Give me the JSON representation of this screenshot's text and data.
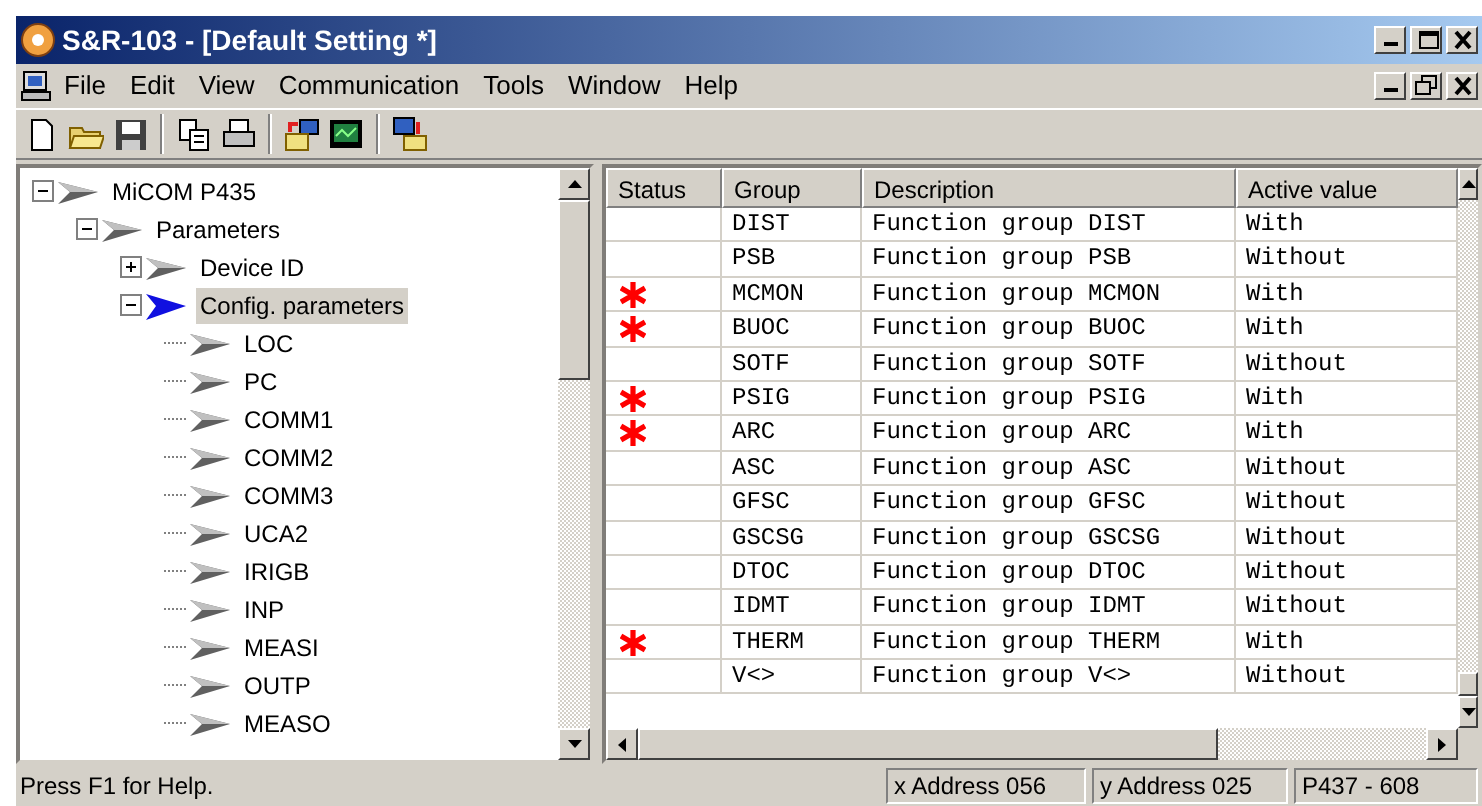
{
  "window": {
    "title": "S&R-103 - [Default Setting *]"
  },
  "menu": [
    "File",
    "Edit",
    "View",
    "Communication",
    "Tools",
    "Window",
    "Help"
  ],
  "tree": [
    {
      "label": "MiCOM P435",
      "expanded": true,
      "selected": false,
      "children": [
        {
          "label": "Parameters",
          "expanded": true,
          "selected": false,
          "children": [
            {
              "label": "Device ID",
              "expanded": false,
              "selected": false
            },
            {
              "label": "Config. parameters",
              "expanded": true,
              "selected": true,
              "children": [
                {
                  "label": "LOC",
                  "selected": false
                },
                {
                  "label": "PC",
                  "selected": false
                },
                {
                  "label": "COMM1",
                  "selected": false
                },
                {
                  "label": "COMM2",
                  "selected": false
                },
                {
                  "label": "COMM3",
                  "selected": false
                },
                {
                  "label": "UCA2",
                  "selected": false
                },
                {
                  "label": "IRIGB",
                  "selected": false
                },
                {
                  "label": "INP",
                  "selected": false
                },
                {
                  "label": "MEASI",
                  "selected": false
                },
                {
                  "label": "OUTP",
                  "selected": false
                },
                {
                  "label": "MEASO",
                  "selected": false
                }
              ]
            }
          ]
        }
      ]
    }
  ],
  "table": {
    "columns": [
      "Status",
      "Group",
      "Description",
      "Active value"
    ],
    "rows": [
      {
        "changed": false,
        "group": "DIST",
        "description": "Function group DIST",
        "value": "With"
      },
      {
        "changed": false,
        "group": "PSB",
        "description": "Function group PSB",
        "value": "Without"
      },
      {
        "changed": true,
        "group": "MCMON",
        "description": "Function group MCMON",
        "value": "With"
      },
      {
        "changed": true,
        "group": "BUOC",
        "description": "Function group BUOC",
        "value": "With"
      },
      {
        "changed": false,
        "group": "SOTF",
        "description": "Function group SOTF",
        "value": "Without"
      },
      {
        "changed": true,
        "group": "PSIG",
        "description": "Function group PSIG",
        "value": "With"
      },
      {
        "changed": true,
        "group": "ARC",
        "description": "Function group ARC",
        "value": "With"
      },
      {
        "changed": false,
        "group": "ASC",
        "description": "Function group ASC",
        "value": "Without"
      },
      {
        "changed": false,
        "group": "GFSC",
        "description": "Function group GFSC",
        "value": "Without"
      },
      {
        "changed": false,
        "group": "GSCSG",
        "description": "Function group GSCSG",
        "value": "Without"
      },
      {
        "changed": false,
        "group": "DTOC",
        "description": "Function group DTOC",
        "value": "Without"
      },
      {
        "changed": false,
        "group": "IDMT",
        "description": "Function group IDMT",
        "value": "Without"
      },
      {
        "changed": true,
        "group": "THERM",
        "description": "Function group THERM",
        "value": "With"
      },
      {
        "changed": false,
        "group": "V<>",
        "description": "Function group V<>",
        "value": "Without"
      }
    ]
  },
  "status_bar": {
    "message": "Press F1 for Help.",
    "panes": [
      "x Address 056",
      "y Address 025",
      "P437 - 608"
    ]
  }
}
